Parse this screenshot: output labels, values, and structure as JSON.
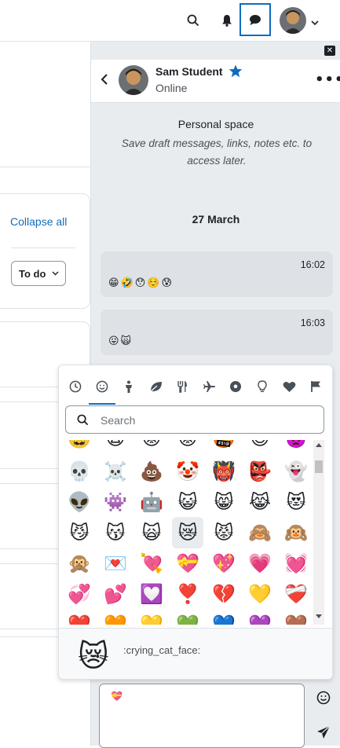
{
  "topbar": {
    "icons": [
      "search-icon",
      "bell-icon",
      "chat-icon",
      "avatar",
      "chevron-down-icon"
    ]
  },
  "page": {
    "collapse_all": "Collapse all",
    "todo_label": "To do"
  },
  "drawer": {
    "close_icon": "close-icon",
    "contact_name": "Sam Student",
    "contact_status": "Online",
    "personal_space_title": "Personal space",
    "personal_space_desc": "Save draft messages, links, notes etc. to access later.",
    "date_header": "27 March",
    "messages": [
      {
        "time": "16:02",
        "content": "😁🤣😯☺️😰"
      },
      {
        "time": "16:03",
        "content": "😛🙀"
      }
    ],
    "compose_value": "💝"
  },
  "emoji_picker": {
    "categories": [
      "recent-clock-icon",
      "smileys-icon",
      "people-icon",
      "nature-leaf-icon",
      "food-fork-knife-icon",
      "travel-plane-icon",
      "activities-ball-icon",
      "objects-bulb-icon",
      "symbols-heart-icon",
      "flags-icon"
    ],
    "active_category": 1,
    "search_placeholder": "Search",
    "rows": [
      [
        "🥸",
        "😫",
        "😡",
        "😟",
        "🤬",
        "😈",
        "👿"
      ],
      [
        "💀",
        "☠️",
        "💩",
        "🤡",
        "👹",
        "👺",
        "👻"
      ],
      [
        "👽",
        "👾",
        "🤖",
        "😺",
        "😸",
        "😹",
        "😻"
      ],
      [
        "😼",
        "😽",
        "🙀",
        "😿",
        "😾",
        "🙈",
        "🙉"
      ],
      [
        "🙊",
        "💌",
        "💘",
        "💝",
        "💖",
        "💗",
        "💓"
      ],
      [
        "💞",
        "💕",
        "💟",
        "❣️",
        "💔",
        "💛",
        "❤️‍🩹"
      ],
      [
        "❤️",
        "🧡",
        "💛",
        "💚",
        "💙",
        "💜",
        "🤎"
      ]
    ],
    "selected": "😿",
    "preview_emoji": "😿",
    "preview_name": ":crying_cat_face:"
  }
}
